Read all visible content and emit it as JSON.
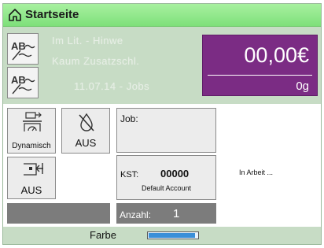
{
  "title": "Startseite",
  "header": {
    "ghost_lines": [
      "Im Lit. - Hinwe",
      "Kaum Zusatzschl.",
      "11.07.14 - Jobs"
    ],
    "amount": "00,00€",
    "weight": "0g"
  },
  "tiles": {
    "dynamic_label": "Dynamisch",
    "ink_mode_label": "AUS",
    "feed_label": "AUS"
  },
  "job": {
    "label": "Job:"
  },
  "account": {
    "kst_label": "KST:",
    "kst_value": "00000",
    "name": "Default Account"
  },
  "status": "In Arbeit ...",
  "counter": {
    "label": "Anzahl:",
    "value": "1"
  },
  "footer": {
    "color_label": "Farbe",
    "ink_level_fraction": 0.95
  },
  "colors": {
    "titlebar": "#8ee68a",
    "accent": "#7b2c84",
    "panel": "#c7dcc5"
  }
}
